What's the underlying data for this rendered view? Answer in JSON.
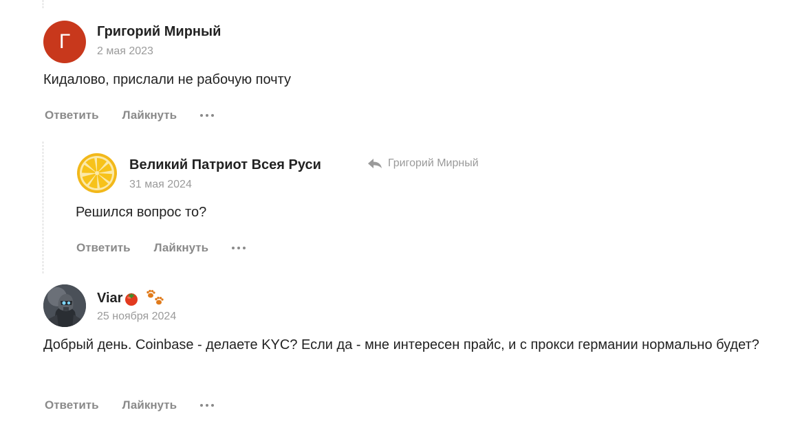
{
  "comments": [
    {
      "author": "Григорий Мирный",
      "avatar_letter": "Г",
      "date": "2 мая 2023",
      "text": "Кидалово, прислали не рабочую почту"
    },
    {
      "author": "Великий Патриот Всея Руси",
      "reply_to": "Григорий Мирный",
      "date": "31 мая 2024",
      "text": "Решился вопрос то?"
    },
    {
      "author": "Viar",
      "date": "25 ноября 2024",
      "text": "Добрый день. Coinbase - делаете KYC? Если да - мне интересен прайс, и с прокси германии нормально будет?"
    }
  ],
  "actions": {
    "reply": "Ответить",
    "like": "Лайкнуть"
  },
  "icons": {
    "reply_arrow": "reply-arrow-icon",
    "more": "more-dots-icon",
    "tomato": "tomato-emoji",
    "paws": "paw-prints-emoji",
    "lemon_avatar": "lemon-slice-avatar"
  },
  "colors": {
    "avatar_red": "#c8381c",
    "muted_text": "#8a8a8a",
    "date_text": "#9a9a9a",
    "lemon": "#f7c21a"
  }
}
